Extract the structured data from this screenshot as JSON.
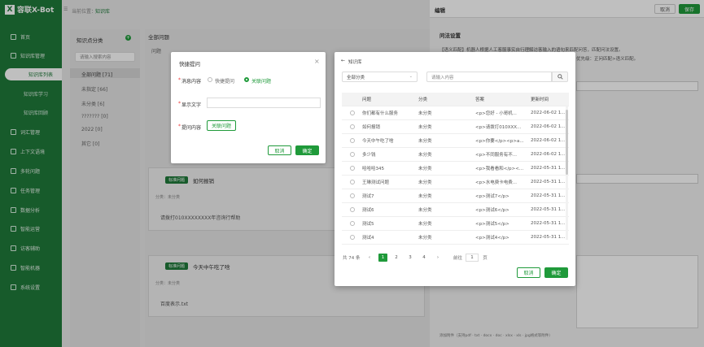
{
  "app": {
    "logo_mark": "X",
    "name": "容联X-Bot"
  },
  "breadcrumb": {
    "prefix": "当前位置：",
    "current": "知识库"
  },
  "sidebar": {
    "items": [
      {
        "label": "首页"
      },
      {
        "label": "知识库管理"
      },
      {
        "label": "知识库列表",
        "sub": true,
        "active": true
      },
      {
        "label": "知识库学习",
        "sub": true
      },
      {
        "label": "知识库回顾",
        "sub": true
      },
      {
        "label": "词汇管理"
      },
      {
        "label": "上下文语境"
      },
      {
        "label": "多轮问题"
      },
      {
        "label": "任务管理"
      },
      {
        "label": "数据分析"
      },
      {
        "label": "智能运营"
      },
      {
        "label": "访客辅助"
      },
      {
        "label": "智能机器"
      },
      {
        "label": "系统设置"
      }
    ]
  },
  "kb_panel": {
    "title": "知识点分类",
    "search_placeholder": "请输入搜索内容",
    "items": [
      "全部问题 [71]",
      "未指定 [66]",
      "未分类 [6]",
      "??????? [0]",
      "2022 [0]",
      "其它 [0]"
    ]
  },
  "main": {
    "title": "全部问题",
    "filter_label": "问题",
    "cards": [
      {
        "tag": "标准问题",
        "title": "如何报销",
        "meta": "分类：未分类",
        "body": "请拨打010XXXXXXXX年咨询行帮助"
      },
      {
        "tag": "标准问题",
        "title": "今天中午吃了啥",
        "meta": "分类：未分类",
        "body": "百度表示.txt"
      }
    ]
  },
  "drawer": {
    "title": "编辑",
    "cancel": "取消",
    "save": "保存",
    "section": "问法设置",
    "desc": "【语义匹配】机器人根据人工客服事实自行理解访客输入的语句来匹配问答，匹配问法设置。",
    "desc2": "优先级：正问匹配>语义匹配。",
    "footer": "添加附件（支持pdf · txt · docx · doc · xlsx · xls · jpg格式等附件）"
  },
  "quick_reply": {
    "title": "快捷提问",
    "content_label": "消息内容",
    "option1": "快捷提问",
    "option2": "关联问题",
    "display_label": "显示文字",
    "question_label": "提问内容",
    "pick_button": "关联问题",
    "cancel": "取消",
    "confirm": "确定"
  },
  "kb_modal": {
    "back_label": "知识库",
    "category_select": "全部分类",
    "search_placeholder": "请输入内容",
    "columns": [
      "问题",
      "分类",
      "答案",
      "更新时间"
    ],
    "rows": [
      [
        "你们都有什么服务",
        "未分类",
        "<p>您好 - 小哥机...",
        "2022-06-02 1..."
      ],
      [
        "如何报销",
        "未分类",
        "<p>请拨打010XXX...",
        "2022-06-02 1..."
      ],
      [
        "今天中午吃了啥",
        "未分类",
        "<p>你要</p><p>a...",
        "2022-06-02 1..."
      ],
      [
        "多少钱",
        "未分类",
        "<p>不同服务有不...",
        "2022-06-02 1..."
      ],
      [
        "哈哈哈345",
        "未分类",
        "<p>我看看和</p><...",
        "2022-05-31 1..."
      ],
      [
        "王琳测试问题",
        "未分类",
        "<p>水电费卡电费...",
        "2022-05-31 1..."
      ],
      [
        "测试7",
        "未分类",
        "<p>测试7</p>",
        "2022-05-31 1..."
      ],
      [
        "测试6",
        "未分类",
        "<p>测试6</p>",
        "2022-05-31 1..."
      ],
      [
        "测试5",
        "未分类",
        "<p>测试5</p>",
        "2022-05-31 1..."
      ],
      [
        "测试4",
        "未分类",
        "<p>测试4</p>",
        "2022-05-31 1..."
      ]
    ],
    "pagination": {
      "total": "共 74 条",
      "pages": [
        "1",
        "2",
        "3",
        "4"
      ],
      "current": "1",
      "goto_label": "前往",
      "goto_value": "1",
      "goto_suffix": "页"
    },
    "cancel": "取消",
    "confirm": "确定"
  },
  "colors": {
    "brand": "#1f7a3a",
    "accent": "#1f9a3a"
  }
}
